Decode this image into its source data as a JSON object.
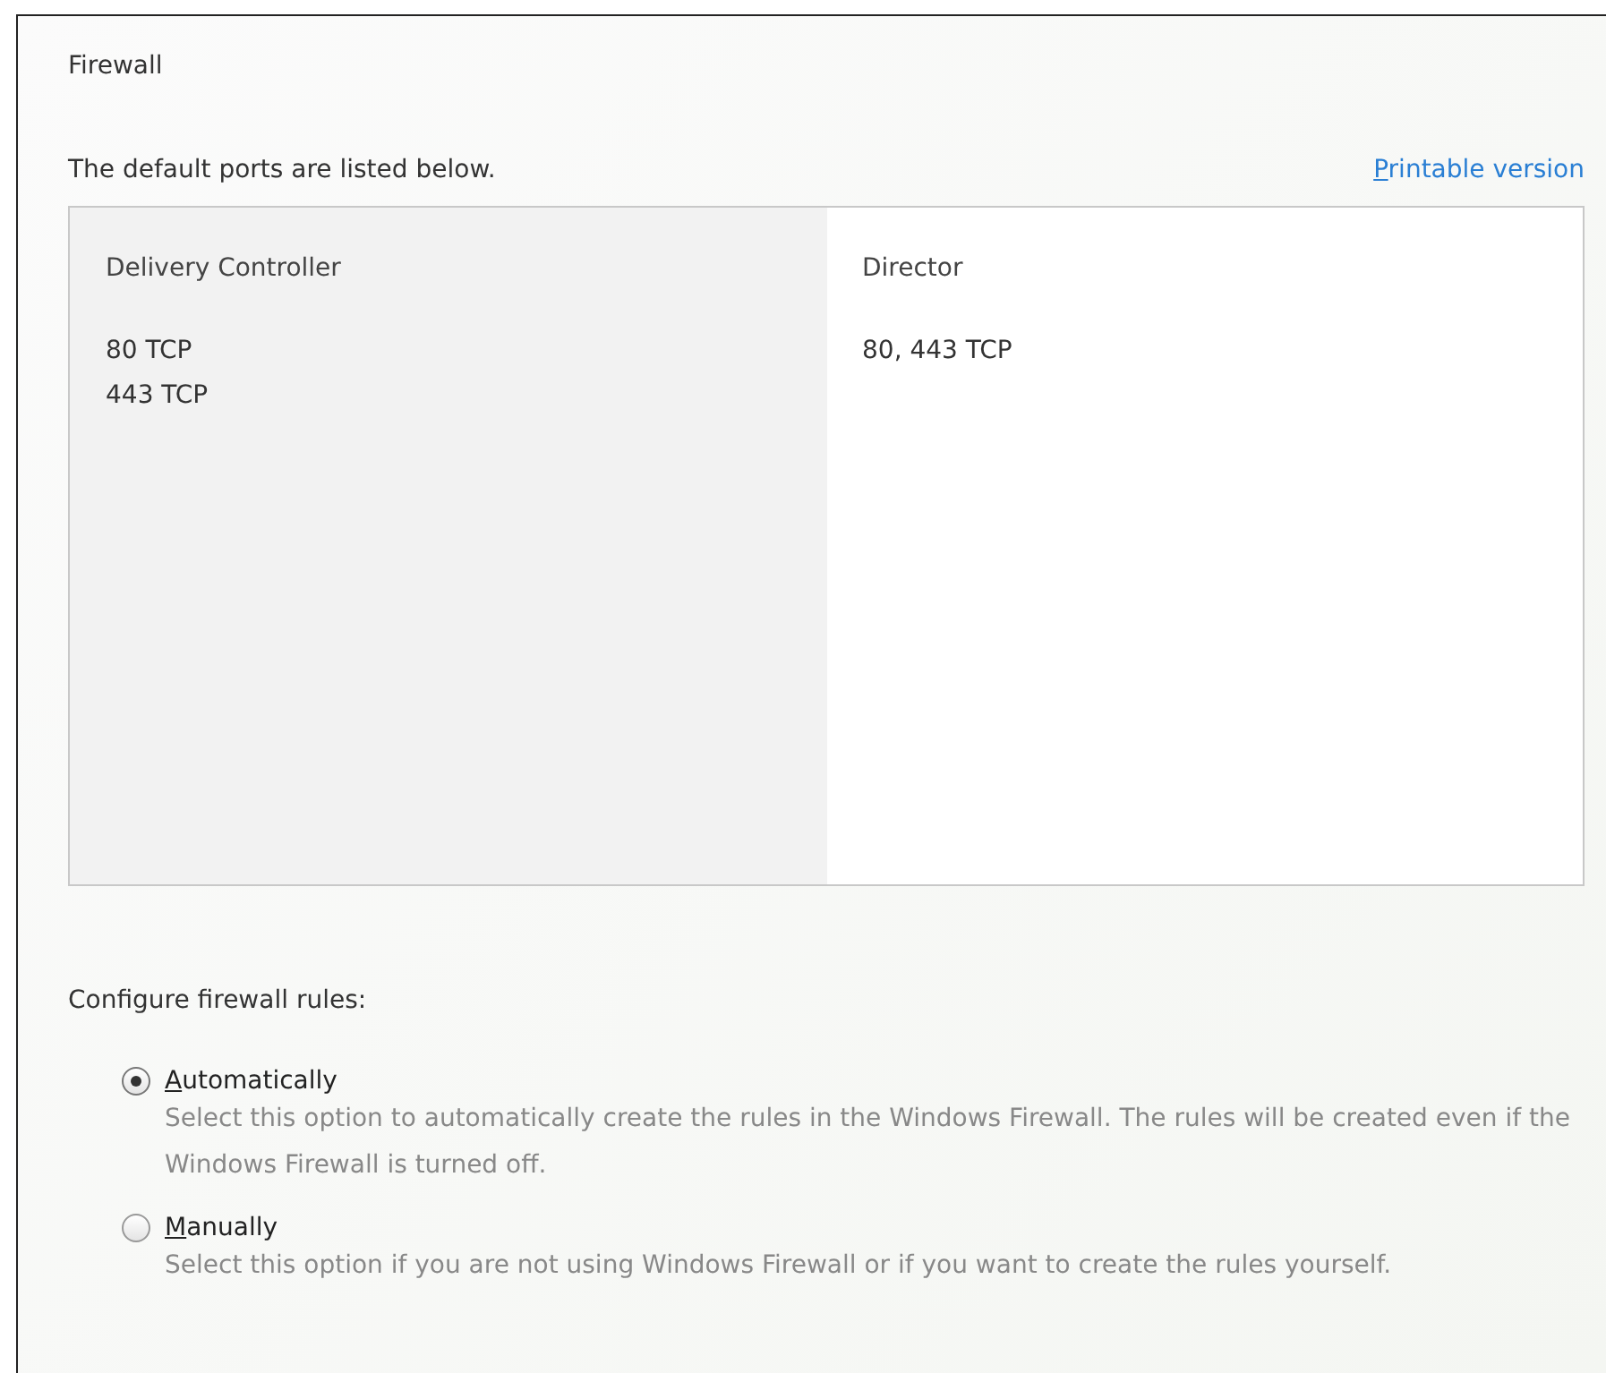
{
  "section_title": "Firewall",
  "intro": "The default ports are listed below.",
  "printable_link": "Printable version",
  "ports": [
    {
      "heading": "Delivery Controller",
      "entries": [
        "80 TCP",
        "443 TCP"
      ]
    },
    {
      "heading": "Director",
      "entries": [
        "80, 443 TCP"
      ]
    }
  ],
  "configure_label": "Configure firewall rules:",
  "options": [
    {
      "label": "Automatically",
      "description": "Select this option to automatically create the rules in the Windows Firewall.  The rules will be created even if the Windows Firewall is turned off.",
      "selected": true
    },
    {
      "label": "Manually",
      "description": "Select this option if you are not using Windows Firewall or if you want to create the rules yourself.",
      "selected": false
    }
  ]
}
